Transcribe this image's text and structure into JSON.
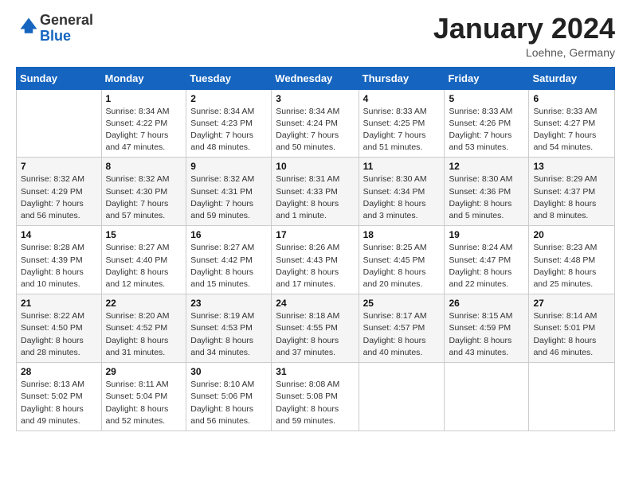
{
  "header": {
    "logo_general": "General",
    "logo_blue": "Blue",
    "month_title": "January 2024",
    "location": "Loehne, Germany"
  },
  "days_of_week": [
    "Sunday",
    "Monday",
    "Tuesday",
    "Wednesday",
    "Thursday",
    "Friday",
    "Saturday"
  ],
  "weeks": [
    [
      {
        "day": "",
        "sunrise": "",
        "sunset": "",
        "daylight": ""
      },
      {
        "day": "1",
        "sunrise": "Sunrise: 8:34 AM",
        "sunset": "Sunset: 4:22 PM",
        "daylight": "Daylight: 7 hours and 47 minutes."
      },
      {
        "day": "2",
        "sunrise": "Sunrise: 8:34 AM",
        "sunset": "Sunset: 4:23 PM",
        "daylight": "Daylight: 7 hours and 48 minutes."
      },
      {
        "day": "3",
        "sunrise": "Sunrise: 8:34 AM",
        "sunset": "Sunset: 4:24 PM",
        "daylight": "Daylight: 7 hours and 50 minutes."
      },
      {
        "day": "4",
        "sunrise": "Sunrise: 8:33 AM",
        "sunset": "Sunset: 4:25 PM",
        "daylight": "Daylight: 7 hours and 51 minutes."
      },
      {
        "day": "5",
        "sunrise": "Sunrise: 8:33 AM",
        "sunset": "Sunset: 4:26 PM",
        "daylight": "Daylight: 7 hours and 53 minutes."
      },
      {
        "day": "6",
        "sunrise": "Sunrise: 8:33 AM",
        "sunset": "Sunset: 4:27 PM",
        "daylight": "Daylight: 7 hours and 54 minutes."
      }
    ],
    [
      {
        "day": "7",
        "sunrise": "Sunrise: 8:32 AM",
        "sunset": "Sunset: 4:29 PM",
        "daylight": "Daylight: 7 hours and 56 minutes."
      },
      {
        "day": "8",
        "sunrise": "Sunrise: 8:32 AM",
        "sunset": "Sunset: 4:30 PM",
        "daylight": "Daylight: 7 hours and 57 minutes."
      },
      {
        "day": "9",
        "sunrise": "Sunrise: 8:32 AM",
        "sunset": "Sunset: 4:31 PM",
        "daylight": "Daylight: 7 hours and 59 minutes."
      },
      {
        "day": "10",
        "sunrise": "Sunrise: 8:31 AM",
        "sunset": "Sunset: 4:33 PM",
        "daylight": "Daylight: 8 hours and 1 minute."
      },
      {
        "day": "11",
        "sunrise": "Sunrise: 8:30 AM",
        "sunset": "Sunset: 4:34 PM",
        "daylight": "Daylight: 8 hours and 3 minutes."
      },
      {
        "day": "12",
        "sunrise": "Sunrise: 8:30 AM",
        "sunset": "Sunset: 4:36 PM",
        "daylight": "Daylight: 8 hours and 5 minutes."
      },
      {
        "day": "13",
        "sunrise": "Sunrise: 8:29 AM",
        "sunset": "Sunset: 4:37 PM",
        "daylight": "Daylight: 8 hours and 8 minutes."
      }
    ],
    [
      {
        "day": "14",
        "sunrise": "Sunrise: 8:28 AM",
        "sunset": "Sunset: 4:39 PM",
        "daylight": "Daylight: 8 hours and 10 minutes."
      },
      {
        "day": "15",
        "sunrise": "Sunrise: 8:27 AM",
        "sunset": "Sunset: 4:40 PM",
        "daylight": "Daylight: 8 hours and 12 minutes."
      },
      {
        "day": "16",
        "sunrise": "Sunrise: 8:27 AM",
        "sunset": "Sunset: 4:42 PM",
        "daylight": "Daylight: 8 hours and 15 minutes."
      },
      {
        "day": "17",
        "sunrise": "Sunrise: 8:26 AM",
        "sunset": "Sunset: 4:43 PM",
        "daylight": "Daylight: 8 hours and 17 minutes."
      },
      {
        "day": "18",
        "sunrise": "Sunrise: 8:25 AM",
        "sunset": "Sunset: 4:45 PM",
        "daylight": "Daylight: 8 hours and 20 minutes."
      },
      {
        "day": "19",
        "sunrise": "Sunrise: 8:24 AM",
        "sunset": "Sunset: 4:47 PM",
        "daylight": "Daylight: 8 hours and 22 minutes."
      },
      {
        "day": "20",
        "sunrise": "Sunrise: 8:23 AM",
        "sunset": "Sunset: 4:48 PM",
        "daylight": "Daylight: 8 hours and 25 minutes."
      }
    ],
    [
      {
        "day": "21",
        "sunrise": "Sunrise: 8:22 AM",
        "sunset": "Sunset: 4:50 PM",
        "daylight": "Daylight: 8 hours and 28 minutes."
      },
      {
        "day": "22",
        "sunrise": "Sunrise: 8:20 AM",
        "sunset": "Sunset: 4:52 PM",
        "daylight": "Daylight: 8 hours and 31 minutes."
      },
      {
        "day": "23",
        "sunrise": "Sunrise: 8:19 AM",
        "sunset": "Sunset: 4:53 PM",
        "daylight": "Daylight: 8 hours and 34 minutes."
      },
      {
        "day": "24",
        "sunrise": "Sunrise: 8:18 AM",
        "sunset": "Sunset: 4:55 PM",
        "daylight": "Daylight: 8 hours and 37 minutes."
      },
      {
        "day": "25",
        "sunrise": "Sunrise: 8:17 AM",
        "sunset": "Sunset: 4:57 PM",
        "daylight": "Daylight: 8 hours and 40 minutes."
      },
      {
        "day": "26",
        "sunrise": "Sunrise: 8:15 AM",
        "sunset": "Sunset: 4:59 PM",
        "daylight": "Daylight: 8 hours and 43 minutes."
      },
      {
        "day": "27",
        "sunrise": "Sunrise: 8:14 AM",
        "sunset": "Sunset: 5:01 PM",
        "daylight": "Daylight: 8 hours and 46 minutes."
      }
    ],
    [
      {
        "day": "28",
        "sunrise": "Sunrise: 8:13 AM",
        "sunset": "Sunset: 5:02 PM",
        "daylight": "Daylight: 8 hours and 49 minutes."
      },
      {
        "day": "29",
        "sunrise": "Sunrise: 8:11 AM",
        "sunset": "Sunset: 5:04 PM",
        "daylight": "Daylight: 8 hours and 52 minutes."
      },
      {
        "day": "30",
        "sunrise": "Sunrise: 8:10 AM",
        "sunset": "Sunset: 5:06 PM",
        "daylight": "Daylight: 8 hours and 56 minutes."
      },
      {
        "day": "31",
        "sunrise": "Sunrise: 8:08 AM",
        "sunset": "Sunset: 5:08 PM",
        "daylight": "Daylight: 8 hours and 59 minutes."
      },
      {
        "day": "",
        "sunrise": "",
        "sunset": "",
        "daylight": ""
      },
      {
        "day": "",
        "sunrise": "",
        "sunset": "",
        "daylight": ""
      },
      {
        "day": "",
        "sunrise": "",
        "sunset": "",
        "daylight": ""
      }
    ]
  ]
}
